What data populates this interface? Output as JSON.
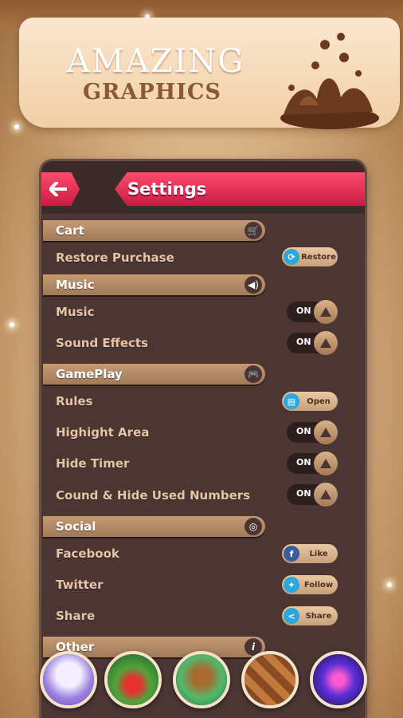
{
  "banner": {
    "line1": "AMAZING",
    "line2": "GRAPHICS"
  },
  "settings": {
    "title": "Settings",
    "sections": {
      "cart": "Cart",
      "music": "Music",
      "gameplay": "GamePlay",
      "social": "Social",
      "other": "Other"
    },
    "rows": {
      "restore_purchase": "Restore Purchase",
      "music": "Music",
      "sound_effects": "Sound Effects",
      "rules": "Rules",
      "highlight_area": "Highight Area",
      "hide_timer": "Hide Timer",
      "count_hide_numbers": "Cound & Hide Used Numbers",
      "facebook": "Facebook",
      "twitter": "Twitter",
      "share": "Share"
    },
    "buttons": {
      "restore": "Restore",
      "open": "Open",
      "like": "Like",
      "follow": "Follow",
      "share": "Share"
    },
    "toggles": {
      "music": "ON",
      "sound_effects": "ON",
      "highlight_area": "ON",
      "hide_timer": "ON",
      "count_hide_numbers": "ON"
    }
  },
  "colors": {
    "accent": "#e32a55",
    "panel": "#4c3634",
    "section": "#b68c68",
    "label": "#e6c4a6"
  },
  "icons": [
    "back-arrow-icon",
    "cart-icon",
    "speaker-icon",
    "gamepad-icon",
    "globe-icon",
    "info-icon",
    "restore-icon",
    "open-book-icon",
    "facebook-icon",
    "twitter-icon",
    "share-icon",
    "triangle-knob-icon"
  ],
  "dock": [
    "bunny-game-icon",
    "racing-game-icon",
    "adventure-game-icon",
    "board-game-icon",
    "neon-game-icon"
  ]
}
